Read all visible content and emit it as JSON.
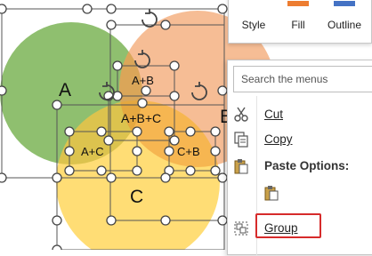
{
  "diagram": {
    "labels": {
      "a": "A",
      "b": "B",
      "c": "C",
      "ab": "A+B",
      "abc": "A+B+C",
      "ac": "A+C",
      "cb": "C+B"
    },
    "colors": {
      "circle_a": "#70ad47",
      "circle_b": "#ed7d31",
      "circle_c": "#ffc000",
      "handle_fill": "#ffffff",
      "handle_stroke": "#444444",
      "selection_box": "#666666"
    }
  },
  "mini_toolbar": {
    "style_label": "Style",
    "fill_label": "Fill",
    "outline_label": "Outline",
    "fill_color": "#ed7d31",
    "outline_color": "#4472c4"
  },
  "context_menu": {
    "search_placeholder": "Search the menus",
    "cut_label": "Cut",
    "copy_label": "Copy",
    "paste_options_label": "Paste Options:",
    "group_label": "Group",
    "highlight_color": "#d62b2b"
  }
}
